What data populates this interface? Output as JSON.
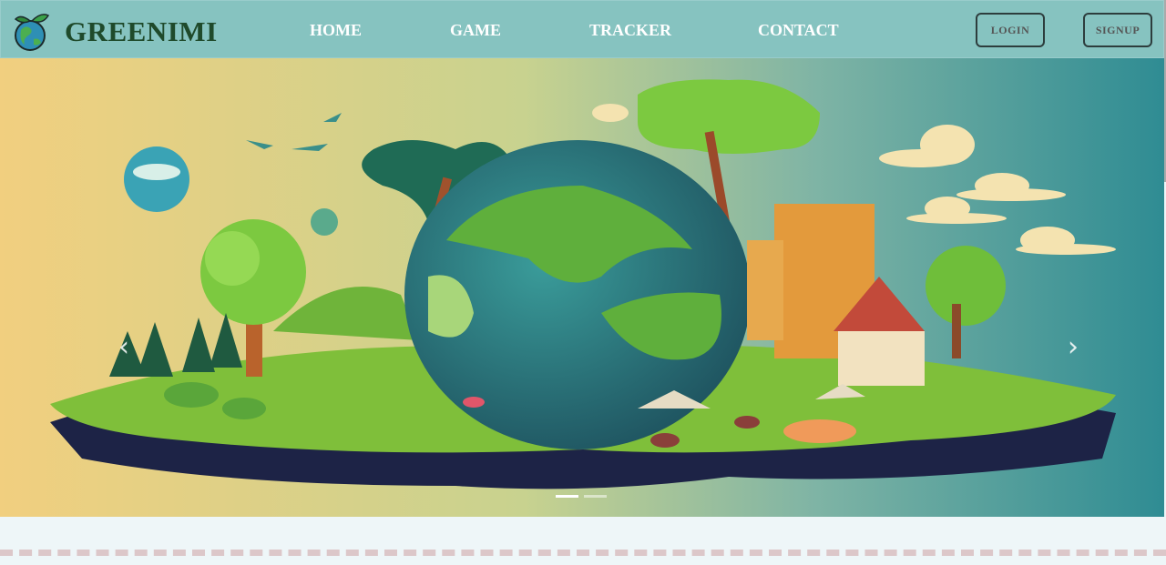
{
  "brand": {
    "name": "GREENIMI",
    "icon": "earth-leaf-logo-icon"
  },
  "nav": {
    "items": [
      {
        "label": "HOME"
      },
      {
        "label": "GAME"
      },
      {
        "label": "TRACKER"
      },
      {
        "label": "CONTACT"
      }
    ]
  },
  "auth": {
    "login_label": "LOGIN",
    "signup_label": "SIGNUP"
  },
  "carousel": {
    "prev_icon": "chevron-left-icon",
    "next_icon": "chevron-right-icon",
    "prev_glyph": "‹",
    "next_glyph": "›",
    "slide_count": 2,
    "active_slide": 1
  },
  "colors": {
    "navbar": "#86c3c0",
    "brand": "#1f4a2b",
    "page_bg": "#eef6f8",
    "dashed_rule": "#dcc7c9"
  }
}
